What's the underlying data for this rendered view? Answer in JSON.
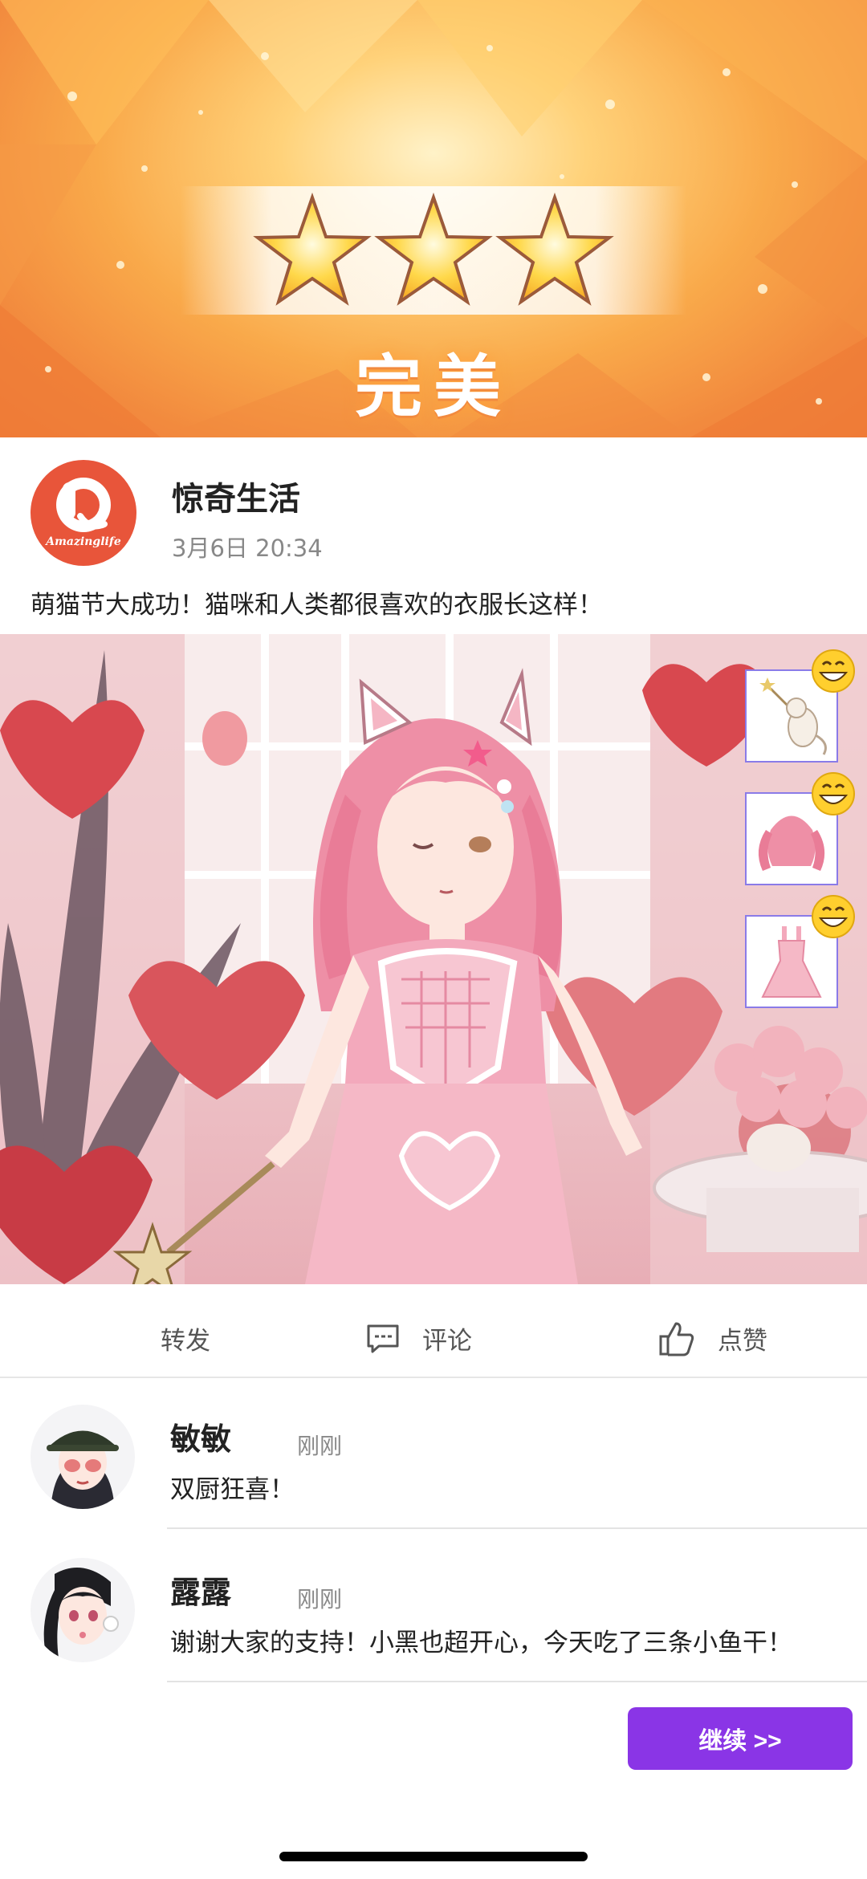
{
  "result": {
    "stars_earned": 3,
    "stars_total": 3,
    "rating_text": "完美"
  },
  "post": {
    "logo_text": "Amazinglife",
    "author": "惊奇生活",
    "timestamp": "3月6日 20:34",
    "text": "萌猫节大成功！猫咪和人类都很喜欢的衣服长这样！",
    "items": [
      {
        "icon": "cat-with-wand-item",
        "badge": "grin-emoji-icon"
      },
      {
        "icon": "pink-twin-tail-wig-item",
        "badge": "grin-emoji-icon"
      },
      {
        "icon": "pink-dress-item",
        "badge": "grin-emoji-icon"
      }
    ]
  },
  "actions": {
    "share": "转发",
    "comment": "评论",
    "like": "点赞"
  },
  "comments": [
    {
      "name": "敏敏",
      "time": "刚刚",
      "text": "双厨狂喜！"
    },
    {
      "name": "露露",
      "time": "刚刚",
      "text": "谢谢大家的支持！小黑也超开心，今天吃了三条小鱼干！"
    }
  ],
  "continue_button": "继续 >>",
  "colors": {
    "accent_purple": "#8a35e6",
    "banner_orange": "#f28a3e",
    "logo_red": "#e8553a",
    "item_border": "#8a7be8"
  }
}
